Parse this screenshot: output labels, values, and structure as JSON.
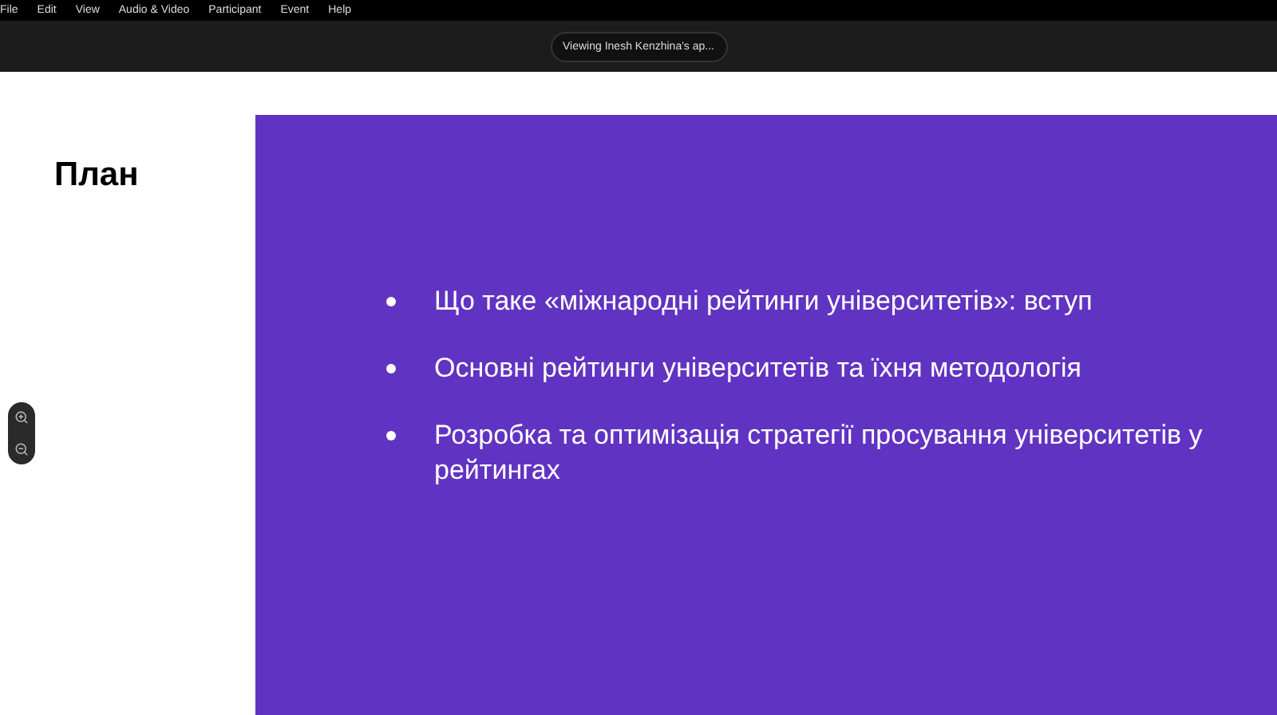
{
  "menu": [
    "File",
    "Edit",
    "View",
    "Audio & Video",
    "Participant",
    "Event",
    "Help"
  ],
  "share_banner": "Viewing Inesh Kenzhina's ap...",
  "slide": {
    "title": "План",
    "bullets": [
      "Що таке «міжнародні рейтинги університетів»: вступ",
      "Основні рейтинги університетів та їхня методологія",
      "Розробка та оптимізація стратегії просування університетів у рейтингах"
    ]
  }
}
